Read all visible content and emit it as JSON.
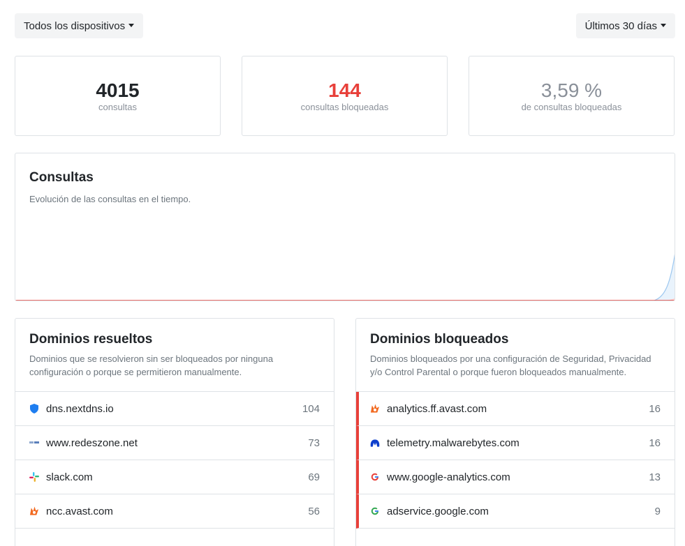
{
  "filters": {
    "devices": "Todos los dispositivos",
    "range": "Últimos 30 días"
  },
  "stats": {
    "queries": {
      "value": "4015",
      "label": "consultas"
    },
    "blocked": {
      "value": "144",
      "label": "consultas bloqueadas"
    },
    "ratio": {
      "value": "3,59 %",
      "label": "de consultas bloqueadas"
    }
  },
  "colors": {
    "blocked_accent": "#e8403a",
    "ratio_grey": "#8a9099",
    "chart_line": "#9cc7ef"
  },
  "chart": {
    "title": "Consultas",
    "subtitle": "Evolución de las consultas en el tiempo."
  },
  "resolved": {
    "title": "Dominios resueltos",
    "subtitle": "Dominios que se resolvieron sin ser bloqueados por ninguna configuración o porque se permitieron manualmente.",
    "items": [
      {
        "domain": "dns.nextdns.io",
        "count": "104",
        "icon": "nextdns-shield-icon"
      },
      {
        "domain": "www.redeszone.net",
        "count": "73",
        "icon": "redeszone-icon"
      },
      {
        "domain": "slack.com",
        "count": "69",
        "icon": "slack-icon"
      },
      {
        "domain": "ncc.avast.com",
        "count": "56",
        "icon": "avast-icon"
      }
    ]
  },
  "blocked": {
    "title": "Dominios bloqueados",
    "subtitle": "Dominios bloqueados por una configuración de Seguridad, Privacidad y/o Control Parental o porque fueron bloqueados manualmente.",
    "items": [
      {
        "domain": "analytics.ff.avast.com",
        "count": "16",
        "icon": "avast-icon"
      },
      {
        "domain": "telemetry.malwarebytes.com",
        "count": "16",
        "icon": "malwarebytes-icon"
      },
      {
        "domain": "www.google-analytics.com",
        "count": "13",
        "icon": "google-icon"
      },
      {
        "domain": "adservice.google.com",
        "count": "9",
        "icon": "google-icon"
      }
    ]
  }
}
